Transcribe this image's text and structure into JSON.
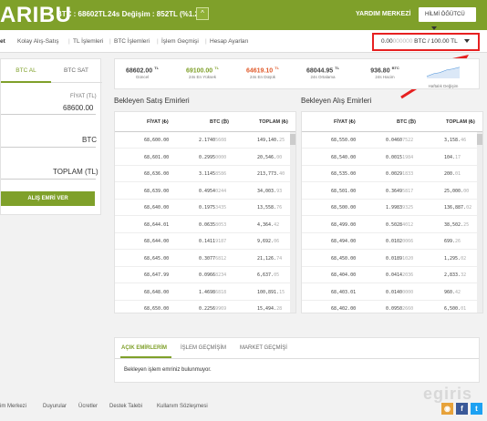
{
  "header": {
    "logo": "ARIBU",
    "ticker": "BTC : 68602TL",
    "change": "24s Değişim : 852TL (%1.26)",
    "up_icon": "chevron-up-icon",
    "help_label": "YARDIM MERKEZİ",
    "user_label": "HİLMİ ÖĞÜTCÜ"
  },
  "nav": {
    "items": [
      "et",
      "Kolay Alış-Satış",
      "TL İşlemleri",
      "BTC İşlemleri",
      "İşlem Geçmişi",
      "Hesap Ayarları"
    ]
  },
  "balance": {
    "btc_bold": "0.00",
    "btc_faded": "000000",
    "rest": " BTC / 100.00 TL"
  },
  "trade": {
    "tab_buy": "BTC AL",
    "tab_sell": "BTC SAT",
    "price_label": "FİYAT (TL)",
    "price_value": "68600.00",
    "amount_unit": "BTC",
    "total_placeholder": "TOPLAM (TL)",
    "buy_button": "ALIŞ EMRİ VER"
  },
  "stats": [
    {
      "value": "68602.00",
      "unit": "TL",
      "label": "Güncel",
      "color": "#555555"
    },
    {
      "value": "69100.00",
      "unit": "TL",
      "label": "24s En Yüksek",
      "color": "#7fa02a"
    },
    {
      "value": "64619.10",
      "unit": "TL",
      "label": "24s En Düşük",
      "color": "#e05a2b"
    },
    {
      "value": "68044.95",
      "unit": "TL",
      "label": "24s Ortalama",
      "color": "#555555"
    },
    {
      "value": "936.80",
      "unit": "BTC",
      "label": "24s Hacim",
      "color": "#555555"
    },
    {
      "value": "",
      "unit": "",
      "label": "Haftalık Değişim",
      "color": "#4a90d9"
    }
  ],
  "sell_book": {
    "title": "Bekleyen Satış Emirleri",
    "headers": [
      "FİYAT (₺)",
      "BTC (₿)",
      "TOPLAM (₺)"
    ],
    "rows": [
      [
        "68,600.00",
        "2.1740",
        "5608",
        "149,140.",
        "25"
      ],
      [
        "68,601.00",
        "0.2995",
        "0000",
        "20,546.",
        "00"
      ],
      [
        "68,636.00",
        "3.1145",
        "8586",
        "213,773.",
        "40"
      ],
      [
        "68,639.00",
        "0.4954",
        "0244",
        "34,003.",
        "93"
      ],
      [
        "68,640.00",
        "0.1975",
        "3435",
        "13,558.",
        "76"
      ],
      [
        "68,644.01",
        "0.0635",
        "8053",
        "4,364.",
        "42"
      ],
      [
        "68,644.00",
        "0.1411",
        "9187",
        "9,692.",
        "06"
      ],
      [
        "68,645.00",
        "0.3077",
        "6812",
        "21,126.",
        "74"
      ],
      [
        "68,647.99",
        "0.0966",
        "8234",
        "6,637.",
        "05"
      ],
      [
        "68,648.00",
        "1.4698",
        "6818",
        "100,891.",
        "15"
      ],
      [
        "68,650.00",
        "0.2256",
        "9969",
        "15,494.",
        "28"
      ]
    ]
  },
  "buy_book": {
    "title": "Bekleyen Alış Emirleri",
    "headers": [
      "FİYAT (₺)",
      "BTC (₿)",
      "TOPLAM (₺)"
    ],
    "rows": [
      [
        "68,550.00",
        "0.0460",
        "7522",
        "3,158.",
        "46"
      ],
      [
        "68,540.00",
        "0.0015",
        "1984",
        "104.",
        "17"
      ],
      [
        "68,535.00",
        "0.0029",
        "1833",
        "200.",
        "01"
      ],
      [
        "68,501.00",
        "0.3649",
        "5817",
        "25,000.",
        "00"
      ],
      [
        "68,500.00",
        "1.9983",
        "9325",
        "136,887.",
        "02"
      ],
      [
        "68,499.00",
        "0.5028",
        "4012",
        "38,502.",
        "25"
      ],
      [
        "68,494.00",
        "0.0102",
        "0066",
        "699.",
        "26"
      ],
      [
        "68,450.00",
        "0.0189",
        "1020",
        "1,295.",
        "02"
      ],
      [
        "68,404.00",
        "0.0414",
        "2036",
        "2,833.",
        "32"
      ],
      [
        "68,403.01",
        "0.0140",
        "0000",
        "960.",
        "42"
      ],
      [
        "68,402.00",
        "0.0950",
        "2660",
        "6,500.",
        "01"
      ]
    ]
  },
  "orders": {
    "tabs": [
      "AÇIK EMİRLERİM",
      "İŞLEM GEÇMİŞİM",
      "MARKET GEÇMİŞİ"
    ],
    "empty": "Bekleyen işlem emriniz bulunmuyor."
  },
  "footer": {
    "links": [
      "im Merkezi",
      "Duyurular",
      "Ücretler",
      "Destek Talebi",
      "Kullanım Sözleşmesi"
    ],
    "watermark": "egiris",
    "social": [
      "rss-icon",
      "facebook-icon",
      "twitter-icon"
    ]
  },
  "colors": {
    "brand": "#7fa02a",
    "highlight": "#e62020"
  }
}
